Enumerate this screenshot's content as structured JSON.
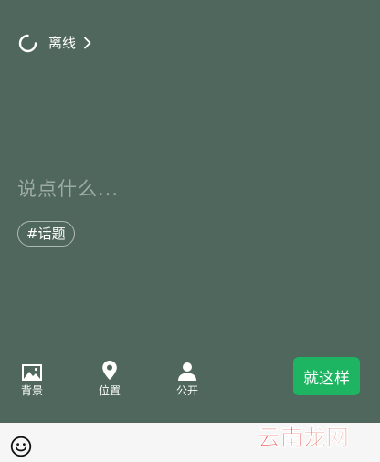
{
  "status": {
    "label": "离线",
    "icon": "loading-spinner-icon",
    "chevron": "chevron-right-icon"
  },
  "compose": {
    "placeholder": "说点什么..."
  },
  "topic": {
    "label": "#话题"
  },
  "toolbar": {
    "items": [
      {
        "label": "背景",
        "icon": "image-icon"
      },
      {
        "label": "位置",
        "icon": "location-pin-icon"
      },
      {
        "label": "公开",
        "icon": "person-icon"
      }
    ],
    "done_label": "就这样"
  },
  "bottom_bar": {
    "emoji_icon": "emoji-icon"
  },
  "watermark": {
    "part1": "云南",
    "part2": "龙网"
  },
  "colors": {
    "background": "#4f675c",
    "accent": "#1db462",
    "bottom_bar": "#f6f6f6"
  }
}
